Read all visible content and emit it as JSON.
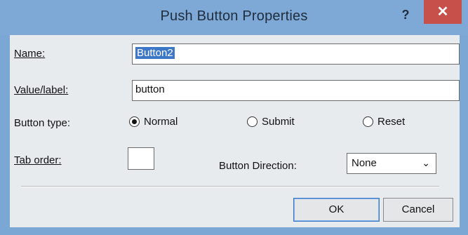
{
  "window": {
    "title": "Push Button Properties",
    "help_label": "?",
    "close_label": "✕"
  },
  "form": {
    "name_label": "Name:",
    "name_value": "Button2",
    "value_label": "Value/label:",
    "value_value": "button",
    "button_type_label": "Button type:",
    "radio_normal": "Normal",
    "radio_submit": "Submit",
    "radio_reset": "Reset",
    "selected_type": "Normal",
    "tab_order_label": "Tab order:",
    "tab_order_value": "",
    "direction_label": "Button Direction:",
    "direction_value": "None"
  },
  "footer": {
    "ok_label": "OK",
    "cancel_label": "Cancel"
  }
}
